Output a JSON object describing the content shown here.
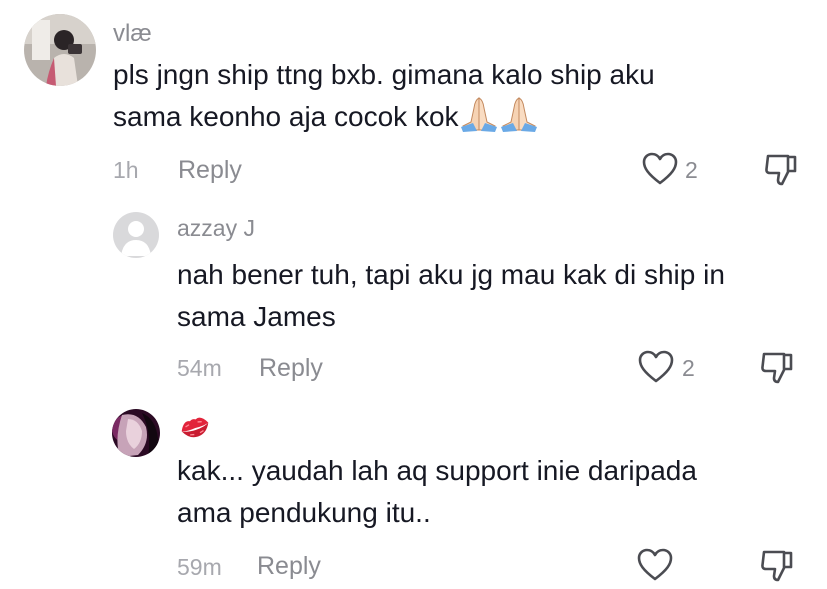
{
  "comments": [
    {
      "username": "vlæ",
      "text_lines": [
        "pls jngn ship ttng bxb. gimana kalo ship aku",
        "sama keonho aja cocok kok"
      ],
      "trailing_emoji": "🙏🏻🙏🏻",
      "time": "1h",
      "reply_label": "Reply",
      "likes": "2"
    },
    {
      "username": "azzay J",
      "text_lines": [
        "nah bener tuh, tapi aku jg mau kak di ship in",
        "sama James"
      ],
      "time": "54m",
      "reply_label": "Reply",
      "likes": "2"
    },
    {
      "username": "💋",
      "text_lines": [
        "kak... yaudah lah aq support inie daripada",
        "ama pendukung itu.."
      ],
      "time": "59m",
      "reply_label": "Reply",
      "likes": ""
    }
  ],
  "icons": {
    "like": "heart-outline-icon",
    "dislike": "thumbs-down-outline-icon",
    "pray": "folded-hands-emoji",
    "kiss": "kiss-mark-emoji"
  },
  "colors": {
    "text": "#161823",
    "username": "#8a8b91",
    "time": "#a7a8ae",
    "icon": "#4b4c52"
  }
}
